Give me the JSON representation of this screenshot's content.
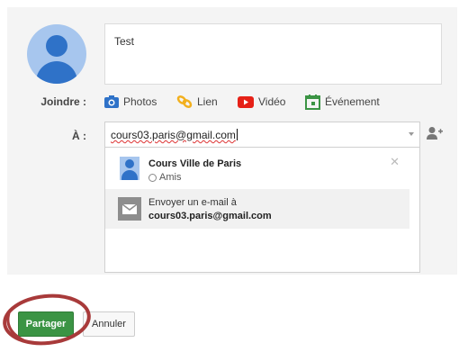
{
  "compose": {
    "text": "Test"
  },
  "attach": {
    "label": "Joindre :",
    "items": [
      {
        "label": "Photos",
        "icon": "camera-icon",
        "color": "#2f72c8"
      },
      {
        "label": "Lien",
        "icon": "link-icon",
        "color": "#f2b01e"
      },
      {
        "label": "Vidéo",
        "icon": "youtube-icon",
        "color": "#e62117"
      },
      {
        "label": "Événement",
        "icon": "calendar-icon",
        "color": "#3b9444"
      }
    ]
  },
  "recipients": {
    "label": "À :",
    "value": "cours03.paris@gmail.com"
  },
  "suggestions": [
    {
      "name": "Cours Ville de Paris",
      "circle": "Amis"
    },
    {
      "line1": "Envoyer un e-mail à",
      "email": "cours03.paris@gmail.com"
    }
  ],
  "actions": {
    "share": "Partager",
    "cancel": "Annuler"
  },
  "colors": {
    "share_button": "#3b9444",
    "annotation": "#a83a3a"
  }
}
